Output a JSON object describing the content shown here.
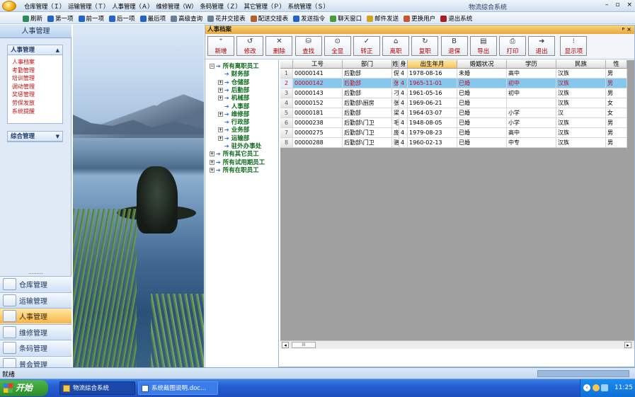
{
  "menu": [
    "仓库管理（Ｉ）",
    "运输管理（Ｔ）",
    "人事管理（Ａ）",
    "维修管理（Ｗ）",
    "条码管理（Ｚ）",
    "其它管理（Ｐ）",
    "系统管理（Ｓ）"
  ],
  "app_title": "物流综合系统",
  "toolbar": [
    {
      "label": "刷新",
      "icon": "refresh-icon"
    },
    {
      "label": "第一项",
      "icon": "first-icon"
    },
    {
      "label": "前一项",
      "icon": "prev-icon"
    },
    {
      "label": "后一项",
      "icon": "next-icon"
    },
    {
      "label": "最后项",
      "icon": "last-icon"
    },
    {
      "label": "高级查询",
      "icon": "query-icon"
    },
    {
      "label": "花井交接表",
      "icon": "table-icon"
    },
    {
      "label": "配送交接表",
      "icon": "truck-icon"
    },
    {
      "label": "发送指令",
      "icon": "send-icon"
    },
    {
      "label": "聊天窗口",
      "icon": "chat-icon"
    },
    {
      "label": "邮件发送",
      "icon": "mail-icon"
    },
    {
      "label": "更换用户",
      "icon": "user-icon"
    },
    {
      "label": "退出系统",
      "icon": "exit-icon"
    }
  ],
  "nav": {
    "header": "人事管理",
    "group1": {
      "title": "人事管理",
      "items": [
        "人事档案",
        "考勤管理",
        "培训管理",
        "调动管理",
        "奖惩管理",
        "劳保发放",
        "系统提醒"
      ]
    },
    "group2": {
      "title": "综合管理"
    },
    "grip": "………",
    "modules": [
      {
        "label": "仓库管理",
        "icon": "warehouse-icon"
      },
      {
        "label": "运输管理",
        "icon": "transport-icon"
      },
      {
        "label": "人事管理",
        "icon": "personnel-icon",
        "active": true
      },
      {
        "label": "维修管理",
        "icon": "repair-icon"
      },
      {
        "label": "条码管理",
        "icon": "barcode-icon"
      },
      {
        "label": "普会管理",
        "icon": "misc-icon"
      }
    ]
  },
  "panel": {
    "title": "人事档案",
    "controls": "ᵖ ×",
    "buttons": [
      {
        "label": "新增",
        "glyph": "⁺"
      },
      {
        "label": "修改",
        "glyph": "↺"
      },
      {
        "label": "删除",
        "glyph": "✕"
      },
      {
        "label": "查找",
        "glyph": "⛁"
      },
      {
        "label": "全显",
        "glyph": "⊙"
      },
      {
        "label": "转正",
        "glyph": "✓"
      },
      {
        "label": "离职",
        "glyph": "⌂"
      },
      {
        "label": "复职",
        "glyph": "↻"
      },
      {
        "label": "退保",
        "glyph": "B"
      },
      {
        "label": "导出",
        "glyph": "▤"
      },
      {
        "label": "打印",
        "glyph": "⎙"
      },
      {
        "label": "退出",
        "glyph": "➜"
      },
      {
        "label": "显示项",
        "glyph": "⁝"
      }
    ]
  },
  "tree": [
    {
      "label": "所有离职员工",
      "toggle": "−",
      "level": 0
    },
    {
      "label": "财务部",
      "toggle": "",
      "level": 1
    },
    {
      "label": "仓储部",
      "toggle": "+",
      "level": 1
    },
    {
      "label": "后勤部",
      "toggle": "+",
      "level": 1
    },
    {
      "label": "机械部",
      "toggle": "+",
      "level": 1
    },
    {
      "label": "人事部",
      "toggle": "",
      "level": 1
    },
    {
      "label": "维修部",
      "toggle": "+",
      "level": 1
    },
    {
      "label": "行政部",
      "toggle": "",
      "level": 1
    },
    {
      "label": "业务部",
      "toggle": "+",
      "level": 1
    },
    {
      "label": "运输部",
      "toggle": "+",
      "level": 1
    },
    {
      "label": "驻外办事处",
      "toggle": "",
      "level": 1
    },
    {
      "label": "所有其它员工",
      "toggle": "+",
      "level": 0
    },
    {
      "label": "所有试用期员工",
      "toggle": "+",
      "level": 0
    },
    {
      "label": "所有在职员工",
      "toggle": "+",
      "level": 0
    }
  ],
  "table": {
    "headers": [
      "",
      "工号",
      "部门",
      "姓",
      "身",
      "出生年月",
      "婚姻状况",
      "学历",
      "民族",
      "性"
    ],
    "rows": [
      [
        "1",
        "00000141",
        "后勤部",
        "倪",
        "4",
        "1978-08-16",
        "未婚",
        "高中",
        "汉族",
        "男"
      ],
      [
        "2",
        "00000142",
        "后勤部",
        "张",
        "4",
        "1965-11-01",
        "已婚",
        "初中",
        "汉族",
        "男"
      ],
      [
        "3",
        "00000143",
        "后勤部",
        "刁",
        "4",
        "1961-05-16",
        "已婚",
        "初中",
        "汉族",
        "男"
      ],
      [
        "4",
        "00000152",
        "后勤部\\厨房",
        "张",
        "4",
        "1969-06-21",
        "已婚",
        "",
        "汉族",
        "女"
      ],
      [
        "5",
        "00000181",
        "后勤部",
        "梁",
        "4",
        "1964-03-07",
        "已婚",
        "小学",
        "汉",
        "女"
      ],
      [
        "6",
        "00000238",
        "后勤部\\门卫",
        "毛",
        "4",
        "1948-08-05",
        "已婚",
        "小学",
        "汉族",
        "男"
      ],
      [
        "7",
        "00000275",
        "后勤部\\门卫",
        "庞",
        "4",
        "1979-08-23",
        "已婚",
        "高中",
        "汉族",
        "男"
      ],
      [
        "8",
        "00000288",
        "后勤部\\门卫",
        "骆",
        "4",
        "1960-02-13",
        "已婚",
        "中专",
        "汉族",
        "男"
      ]
    ],
    "selected_row": 1,
    "scroll_thumb": "III"
  },
  "status": "就绪",
  "taskbar": {
    "start": "开始",
    "windows": [
      "物流综合系统",
      "系统截图说明.doc..."
    ],
    "clock": "11:25"
  }
}
